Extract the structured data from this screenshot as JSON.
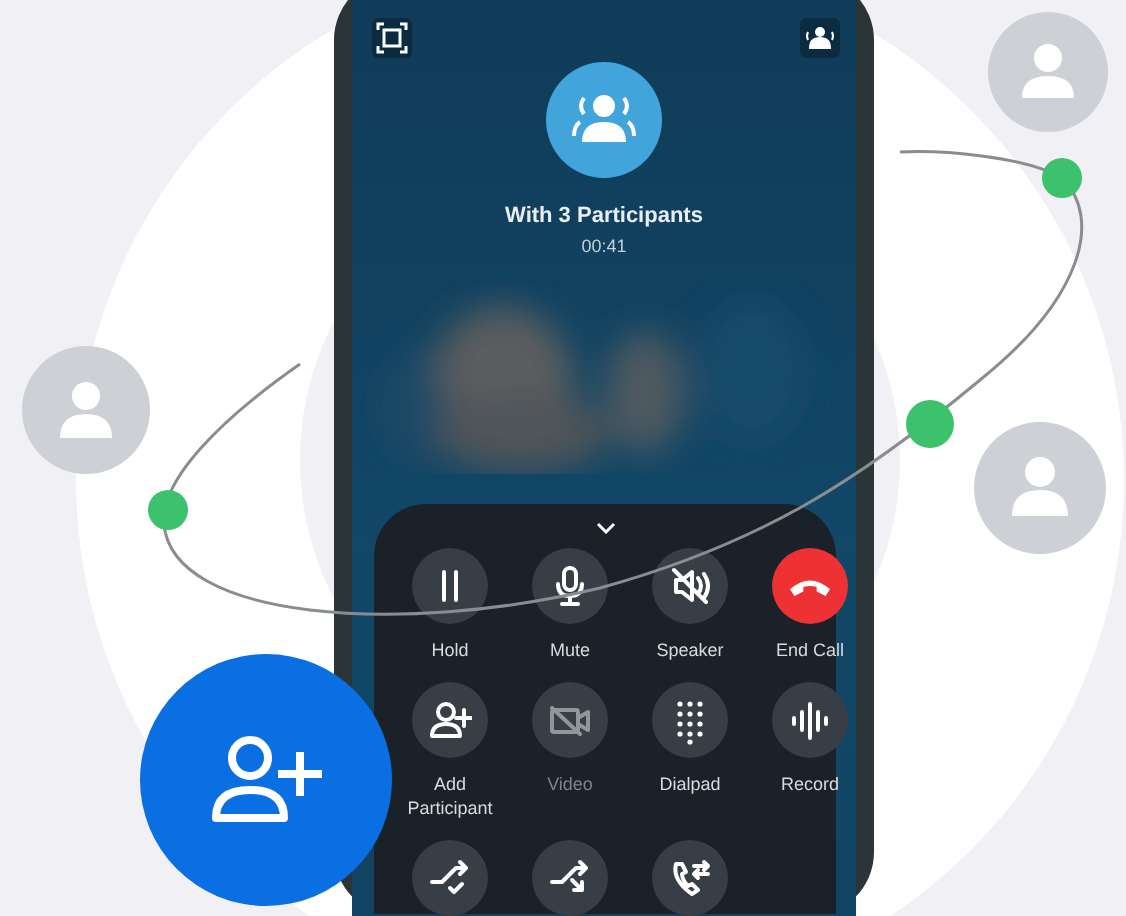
{
  "call": {
    "title": "With 3 Participants",
    "duration": "00:41"
  },
  "controls": [
    {
      "kind": "hold",
      "label": "Hold",
      "disabled": false
    },
    {
      "kind": "mute",
      "label": "Mute",
      "disabled": false
    },
    {
      "kind": "speaker",
      "label": "Speaker",
      "disabled": false
    },
    {
      "kind": "end-call",
      "label": "End Call",
      "disabled": false
    },
    {
      "kind": "add-participant",
      "label": "Add Participant",
      "disabled": false
    },
    {
      "kind": "video",
      "label": "Video",
      "disabled": true
    },
    {
      "kind": "dialpad",
      "label": "Dialpad",
      "disabled": false
    },
    {
      "kind": "record",
      "label": "Record",
      "disabled": false
    },
    {
      "kind": "merge",
      "disabled": false
    },
    {
      "kind": "transfer",
      "disabled": false
    },
    {
      "kind": "swap",
      "disabled": false
    }
  ]
}
